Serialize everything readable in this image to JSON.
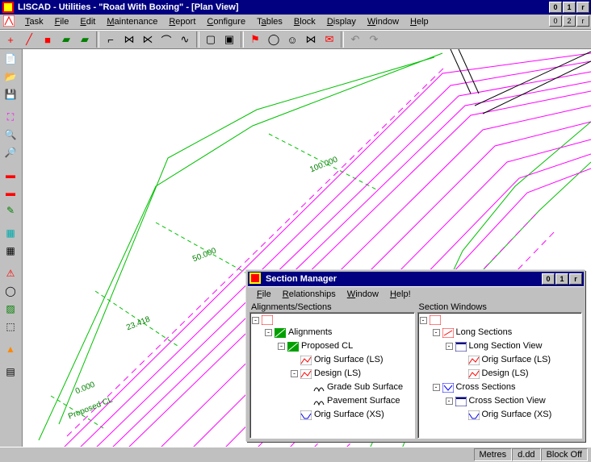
{
  "window": {
    "title": "LISCAD - Utilities - \"Road With Boxing\" - [Plan View]"
  },
  "menubar": {
    "items": [
      "Task",
      "File",
      "Edit",
      "Maintenance",
      "Report",
      "Configure",
      "Tables",
      "Block",
      "Display",
      "Window",
      "Help"
    ]
  },
  "statusbar": {
    "units": "Metres",
    "format": "d.dd",
    "block": "Block Off"
  },
  "canvas_labels": {
    "proposed": "Proposed CL",
    "m0": "0.000",
    "m23": "23.418",
    "m50": "50.000",
    "m100": "100.000"
  },
  "section_manager": {
    "title": "Section Manager",
    "menu": [
      "File",
      "Relationships",
      "Window",
      "Help!"
    ],
    "left_title": "Alignments/Sections",
    "right_title": "Section Windows",
    "left_tree": [
      {
        "indent": 0,
        "toggle": "-",
        "icon": "app",
        "label": ""
      },
      {
        "indent": 1,
        "toggle": "-",
        "icon": "align",
        "label": "Alignments"
      },
      {
        "indent": 2,
        "toggle": "-",
        "icon": "align",
        "label": "Proposed CL"
      },
      {
        "indent": 3,
        "toggle": "",
        "icon": "ls",
        "label": "Orig Surface (LS)"
      },
      {
        "indent": 3,
        "toggle": "-",
        "icon": "ls",
        "label": "Design (LS)"
      },
      {
        "indent": 4,
        "toggle": "",
        "icon": "surf",
        "label": "Grade Sub Surface"
      },
      {
        "indent": 4,
        "toggle": "",
        "icon": "surf",
        "label": "Pavement Surface"
      },
      {
        "indent": 3,
        "toggle": "",
        "icon": "xs",
        "label": "Orig Surface (XS)"
      }
    ],
    "right_tree": [
      {
        "indent": 0,
        "toggle": "-",
        "icon": "app",
        "label": ""
      },
      {
        "indent": 1,
        "toggle": "-",
        "icon": "ls-win",
        "label": "Long Sections"
      },
      {
        "indent": 2,
        "toggle": "-",
        "icon": "view",
        "label": "Long Section View"
      },
      {
        "indent": 3,
        "toggle": "",
        "icon": "ls",
        "label": "Orig Surface (LS)"
      },
      {
        "indent": 3,
        "toggle": "",
        "icon": "ls",
        "label": "Design (LS)"
      },
      {
        "indent": 1,
        "toggle": "-",
        "icon": "xs-win",
        "label": "Cross Sections"
      },
      {
        "indent": 2,
        "toggle": "-",
        "icon": "view",
        "label": "Cross Section View"
      },
      {
        "indent": 3,
        "toggle": "",
        "icon": "xs",
        "label": "Orig Surface (XS)"
      }
    ]
  }
}
